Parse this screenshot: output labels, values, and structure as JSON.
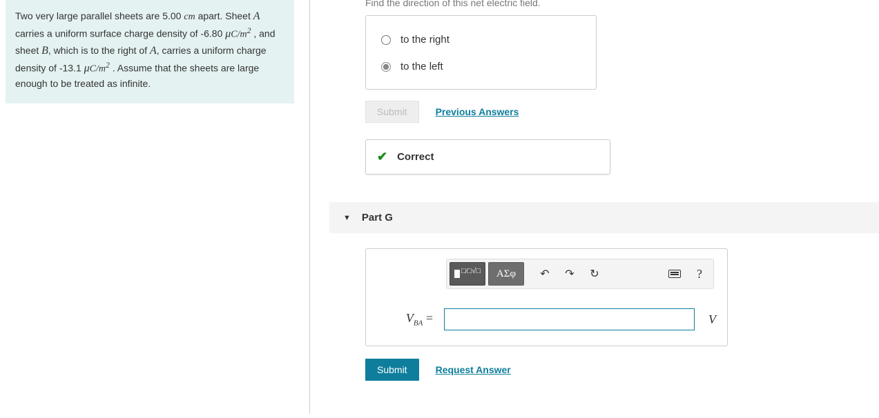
{
  "problem": {
    "text_1": "Two very large parallel sheets are 5.00 ",
    "unit_cm": "cm",
    "text_2": " apart. Sheet ",
    "A": "A",
    "text_3": " carries a uniform surface charge density of -6.80 ",
    "mu": "μ",
    "unit_muC": "C/m",
    "sq": "2",
    "text_4": " , and sheet ",
    "B": "B",
    "text_5": ", which is to the right of ",
    "text_6": ", carries a uniform charge density of -13.1 ",
    "text_7": " . Assume that the sheets are large enough to be treated as infinite."
  },
  "prevPart": {
    "instruction": "Find the direction of this net electric field.",
    "options": {
      "right": "to the right",
      "left": "to the left"
    },
    "submit": "Submit",
    "prev": "Previous Answers",
    "correct": "Correct"
  },
  "partG": {
    "label": "Part G",
    "greek_btn": "ΑΣφ",
    "var_V": "V",
    "var_sub": "BA",
    "equals": " = ",
    "input_value": "",
    "unit": "V",
    "submit": "Submit",
    "request": "Request Answer"
  }
}
